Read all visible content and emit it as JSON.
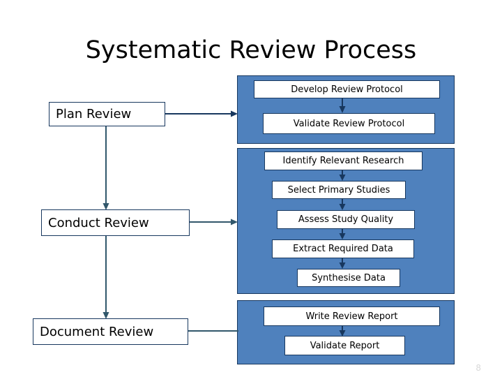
{
  "slide": {
    "title": "Systematic Review Process",
    "page_number": "8",
    "colors": {
      "panel_fill": "#4F81BD",
      "panel_border": "#17375E",
      "box_fill": "#FFFFFF",
      "box_border": "#17375E",
      "connector": "#31576B",
      "inner_arrow": "#17375E",
      "title_text": "#000000",
      "page_number_text": "#D9D9D9"
    }
  },
  "diagram": {
    "type": "flowchart",
    "stages": [
      {
        "id": "plan-review",
        "label": "Plan Review",
        "group_label": "panel-plan",
        "tasks": [
          {
            "id": "develop-review-protocol",
            "label": "Develop Review Protocol"
          },
          {
            "id": "validate-review-protocol",
            "label": "Validate Review Protocol"
          }
        ]
      },
      {
        "id": "conduct-review",
        "label": "Conduct Review",
        "group_label": "panel-conduct",
        "tasks": [
          {
            "id": "identify-relevant-research",
            "label": "Identify Relevant Research"
          },
          {
            "id": "select-primary-studies",
            "label": "Select Primary Studies"
          },
          {
            "id": "assess-study-quality",
            "label": "Assess Study Quality"
          },
          {
            "id": "extract-required-data",
            "label": "Extract Required Data"
          },
          {
            "id": "synthesise-data",
            "label": "Synthesise Data"
          }
        ]
      },
      {
        "id": "document-review",
        "label": "Document Review",
        "group_label": "panel-document",
        "tasks": [
          {
            "id": "write-review-report",
            "label": "Write Review Report"
          },
          {
            "id": "validate-report",
            "label": "Validate Report"
          }
        ]
      }
    ],
    "connectors": [
      {
        "id": "plan-to-conduct",
        "from": "plan-review",
        "to": "conduct-review",
        "direction": "down"
      },
      {
        "id": "conduct-to-document",
        "from": "conduct-review",
        "to": "document-review",
        "direction": "down"
      },
      {
        "id": "plan-to-panel",
        "from": "plan-review",
        "to": "panel-plan",
        "direction": "right"
      },
      {
        "id": "conduct-to-panel",
        "from": "conduct-review",
        "to": "panel-conduct",
        "direction": "right"
      },
      {
        "id": "document-to-panel",
        "from": "document-review",
        "to": "panel-document",
        "direction": "right"
      },
      {
        "id": "develop-to-validate-protocol",
        "from": "develop-review-protocol",
        "to": "validate-review-protocol",
        "direction": "down"
      },
      {
        "id": "identify-to-select",
        "from": "identify-relevant-research",
        "to": "select-primary-studies",
        "direction": "down"
      },
      {
        "id": "select-to-assess",
        "from": "select-primary-studies",
        "to": "assess-study-quality",
        "direction": "down"
      },
      {
        "id": "assess-to-extract",
        "from": "assess-study-quality",
        "to": "extract-required-data",
        "direction": "down"
      },
      {
        "id": "extract-to-synthesise",
        "from": "extract-required-data",
        "to": "synthesise-data",
        "direction": "down"
      },
      {
        "id": "write-to-validate-report",
        "from": "write-review-report",
        "to": "validate-report",
        "direction": "down"
      }
    ]
  }
}
